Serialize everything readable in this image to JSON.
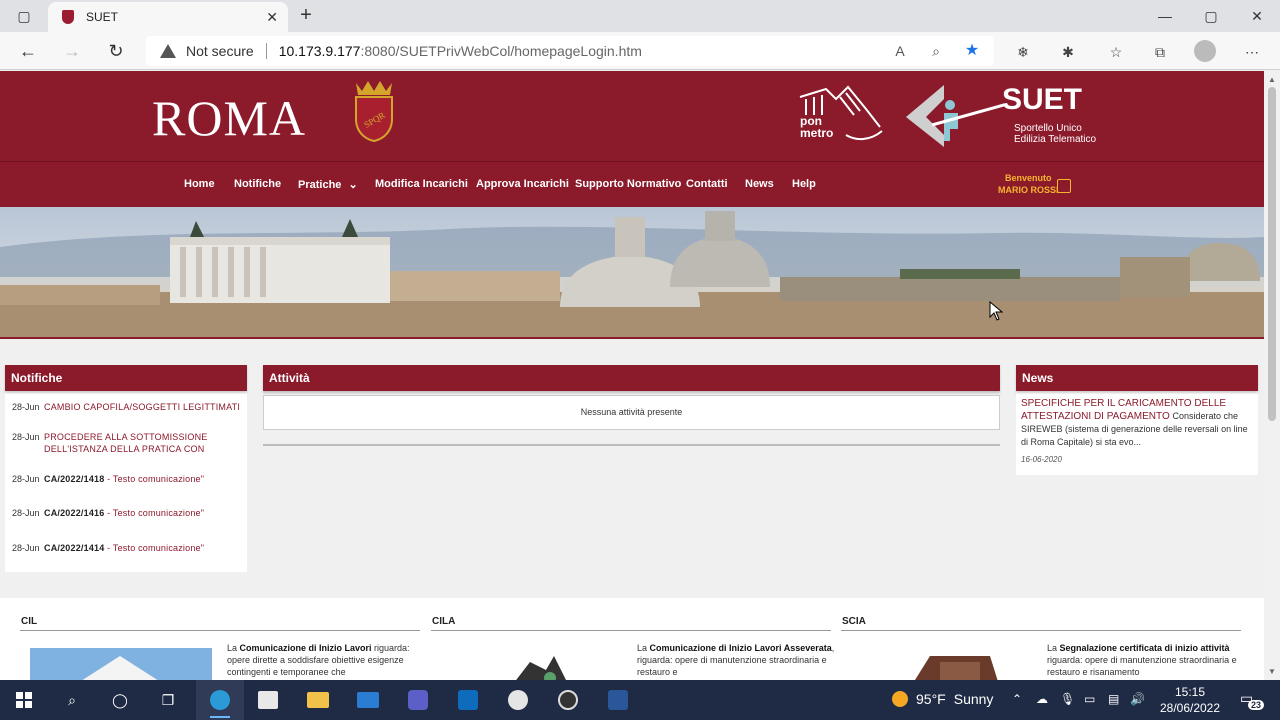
{
  "browser": {
    "tab_title": "SUET",
    "security_label": "Not secure",
    "url_host": "10.173.9.177",
    "url_path": ":8080/SUETPrivWebCol/homepageLogin.htm"
  },
  "header": {
    "city": "ROMA",
    "shield_text": "SPQR",
    "pon_text_1": "pon",
    "pon_text_2": "metro",
    "suet_title": "SUET",
    "suet_sub_1": "Sportello Unico",
    "suet_sub_2": "Edilizia Telematico"
  },
  "menu": {
    "items": [
      "Home",
      "Notifiche",
      "Pratiche",
      "Modifica Incarichi",
      "Approva Incarichi",
      "Supporto Normativo",
      "Contatti",
      "News",
      "Help"
    ],
    "chevron": "⌄",
    "welcome_label": "Benvenuto",
    "user_name": "MARIO ROSSI"
  },
  "notifiche": {
    "title": "Notifiche",
    "rows": [
      {
        "date": "28-Jun",
        "text": "CAMBIO CAPOFILA/SOGGETTI LEGITTIMATI",
        "code": "",
        "link": ""
      },
      {
        "date": "28-Jun",
        "text": "PROCEDERE ALLA SOTTOMISSIONE DELL'ISTANZA DELLA PRATICA CON",
        "code": "",
        "link": ""
      },
      {
        "date": "28-Jun",
        "text": "",
        "code": "CA/2022/1418",
        "link": " - Testo comunicazione\""
      },
      {
        "date": "28-Jun",
        "text": "",
        "code": "CA/2022/1416",
        "link": " - Testo comunicazione\""
      },
      {
        "date": "28-Jun",
        "text": "",
        "code": "CA/2022/1414",
        "link": " - Testo comunicazione\""
      }
    ]
  },
  "attivita": {
    "title": "Attività",
    "empty_message": "Nessuna attività presente"
  },
  "news": {
    "title": "News",
    "item_title": "SPECIFICHE PER IL CARICAMENTO DELLE ATTESTAZIONI DI PAGAMENTO",
    "item_body": "Considerato che SIREWEB (sistema di generazione delle reversali on line di Roma Capitale) si sta evo...",
    "item_date": "16-06-2020"
  },
  "bottom": {
    "cil": {
      "heading": "CIL",
      "pre": "La ",
      "bold": "Comunicazione di Inizio Lavori",
      "rest": " riguarda: opere dirette a soddisfare obiettive esigenze contingenti e temporanee che"
    },
    "cila": {
      "heading": "CILA",
      "pre": "La ",
      "bold": "Comunicazione di Inizio Lavori Asseverata",
      "rest": ", riguarda: opere di manutenzione straordinaria e restauro e"
    },
    "scia": {
      "heading": "SCIA",
      "pre": "La ",
      "bold": "Segnalazione certificata di inizio attività",
      "rest": " riguarda: opere di manutenzione straordinaria e restauro e risanamento"
    }
  },
  "taskbar": {
    "temperature": "95°F",
    "condition": "Sunny",
    "time": "15:15",
    "date": "28/06/2022",
    "notification_count": "23"
  },
  "colors": {
    "brand": "#8b1a2b",
    "accent": "#f5b52e"
  }
}
